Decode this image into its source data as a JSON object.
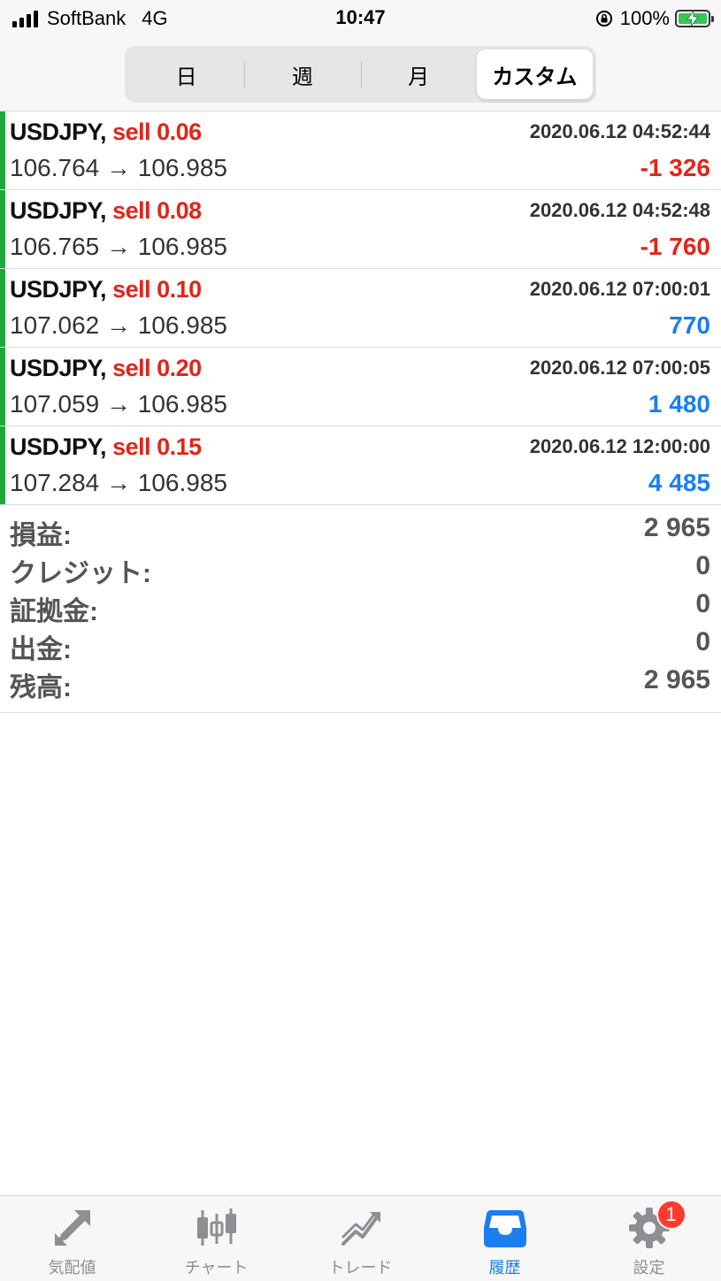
{
  "status_bar": {
    "carrier": "SoftBank",
    "network": "4G",
    "time": "10:47",
    "battery": "100%"
  },
  "segments": [
    {
      "label": "日",
      "active": false
    },
    {
      "label": "週",
      "active": false
    },
    {
      "label": "月",
      "active": false
    },
    {
      "label": "カスタム",
      "active": true
    }
  ],
  "trades": [
    {
      "symbol": "USDJPY,",
      "side": "sell 0.06",
      "time": "2020.06.12 04:52:44",
      "prices": "106.764 → 106.985",
      "profit": "-1 326",
      "profit_sign": "neg"
    },
    {
      "symbol": "USDJPY,",
      "side": "sell 0.08",
      "time": "2020.06.12 04:52:48",
      "prices": "106.765 → 106.985",
      "profit": "-1 760",
      "profit_sign": "neg"
    },
    {
      "symbol": "USDJPY,",
      "side": "sell 0.10",
      "time": "2020.06.12 07:00:01",
      "prices": "107.062 → 106.985",
      "profit": "770",
      "profit_sign": "pos"
    },
    {
      "symbol": "USDJPY,",
      "side": "sell 0.20",
      "time": "2020.06.12 07:00:05",
      "prices": "107.059 → 106.985",
      "profit": "1 480",
      "profit_sign": "pos"
    },
    {
      "symbol": "USDJPY,",
      "side": "sell 0.15",
      "time": "2020.06.12 12:00:00",
      "prices": "107.284 → 106.985",
      "profit": "4 485",
      "profit_sign": "pos"
    }
  ],
  "summary": {
    "profit_label": "損益:",
    "profit_value": "2 965",
    "credit_label": "クレジット:",
    "credit_value": "0",
    "deposit_label": "証拠金:",
    "deposit_value": "0",
    "withdrawal_label": "出金:",
    "withdrawal_value": "0",
    "balance_label": "残高:",
    "balance_value": "2 965"
  },
  "tabbar": {
    "quotes": "気配値",
    "chart": "チャート",
    "trade": "トレード",
    "history": "履歴",
    "settings": "設定",
    "settings_badge": "1"
  },
  "colors": {
    "sell": "#e0251b",
    "negative": "#e0251b",
    "positive": "#1a7ef0",
    "row_marker": "#1fa83a",
    "active_tab": "#1a7ef0",
    "inactive_tab": "#8e8e93"
  },
  "icons": {
    "quotes": "arrows-diagonal-icon",
    "chart": "candlestick-icon",
    "trade": "trend-line-icon",
    "history": "inbox-tray-icon",
    "settings": "gear-icon"
  }
}
